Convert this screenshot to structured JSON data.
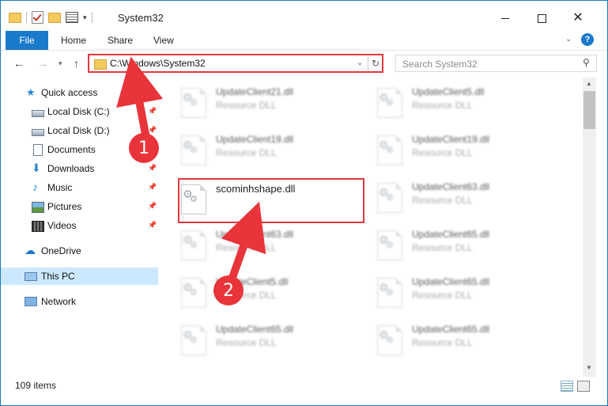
{
  "window": {
    "title": "System32",
    "controls": {
      "minimize_icon": "minimize-icon",
      "maximize_icon": "maximize-icon",
      "close_icon": "close-icon"
    }
  },
  "ribbon": {
    "file": "File",
    "home": "Home",
    "share": "Share",
    "view": "View",
    "help": "?"
  },
  "address": {
    "path": "C:\\Windows\\System32",
    "search_placeholder": "Search System32"
  },
  "sidebar": {
    "items": [
      {
        "label": "Quick access",
        "icon": "star-icon",
        "pinned": false
      },
      {
        "label": "Local Disk (C:)",
        "icon": "drive-icon",
        "pinned": true
      },
      {
        "label": "Local Disk (D:)",
        "icon": "drive-icon",
        "pinned": true
      },
      {
        "label": "Documents",
        "icon": "documents-icon",
        "pinned": true
      },
      {
        "label": "Downloads",
        "icon": "download-icon",
        "pinned": true
      },
      {
        "label": "Music",
        "icon": "music-icon",
        "pinned": true
      },
      {
        "label": "Pictures",
        "icon": "pictures-icon",
        "pinned": true
      },
      {
        "label": "Videos",
        "icon": "videos-icon",
        "pinned": true
      },
      {
        "label": "OneDrive",
        "icon": "cloud-icon",
        "pinned": false
      },
      {
        "label": "This PC",
        "icon": "computer-icon",
        "pinned": false,
        "selected": true
      },
      {
        "label": "Network",
        "icon": "network-icon",
        "pinned": false
      }
    ]
  },
  "files": {
    "left": [
      {
        "name": "UpdateClient21.dll",
        "type": "Resource DLL"
      },
      {
        "name": "UpdateClient19.dll",
        "type": "Resource DLL"
      },
      {
        "name": "scominhshape.dll",
        "type": ""
      },
      {
        "name": "UpdateClient63.dll",
        "type": "Resource DLL"
      },
      {
        "name": "UpdateClient5.dll",
        "type": "Resource DLL"
      },
      {
        "name": "UpdateClient65.dll",
        "type": "Resource DLL"
      }
    ],
    "right": [
      {
        "name": "UpdateClient5.dll",
        "type": "Resource DLL"
      },
      {
        "name": "UpdateClient19.dll",
        "type": "Resource DLL"
      },
      {
        "name": "UpdateClient63.dll",
        "type": "Resource DLL"
      },
      {
        "name": "UpdateClient65.dll",
        "type": "Resource DLL"
      },
      {
        "name": "UpdateClient65.dll",
        "type": "Resource DLL"
      },
      {
        "name": "UpdateClient65.dll",
        "type": "Resource DLL"
      }
    ]
  },
  "status": {
    "count": "109 items"
  },
  "annotations": {
    "badge1": "1",
    "badge2": "2",
    "accent": "#e8343a"
  },
  "colors": {
    "accent": "#1979ca",
    "selection": "#cce8ff",
    "highlight": "#e0393e"
  }
}
